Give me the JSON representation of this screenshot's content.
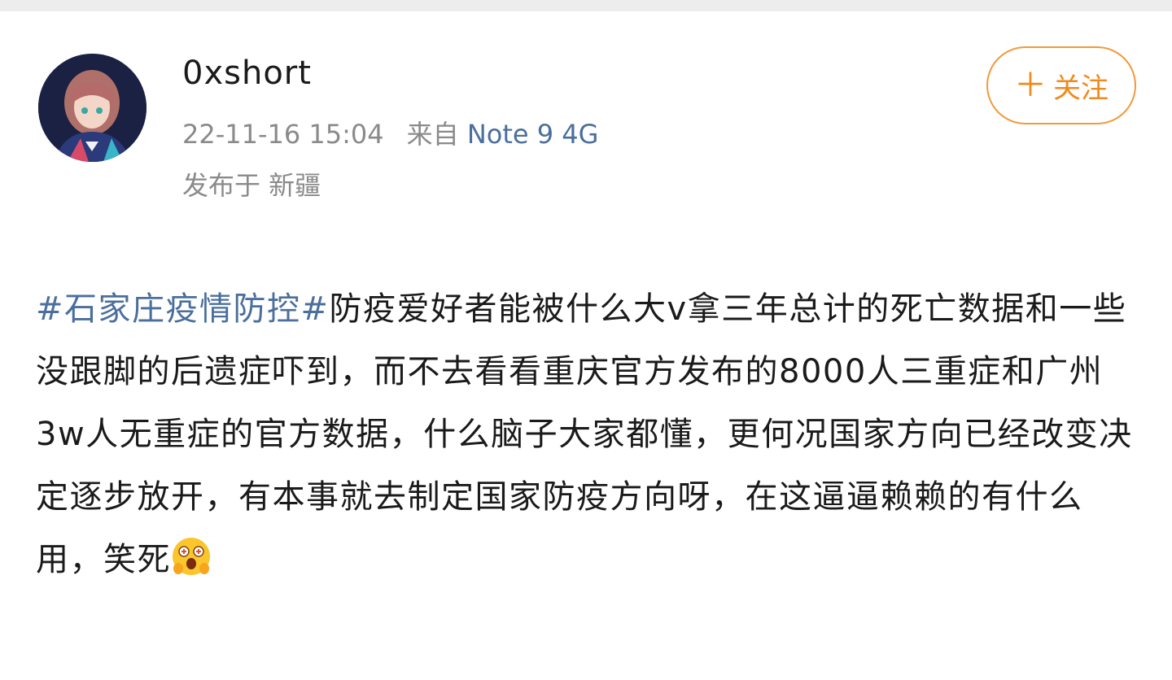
{
  "post": {
    "author": {
      "username": "0xshort",
      "avatar_icon": "avatar-anime-girl"
    },
    "timestamp": "22-11-16 15:04",
    "source_prefix": "来自",
    "device": "Note 9 4G",
    "location": "发布于 新疆",
    "follow_button": {
      "icon": "plus-icon",
      "label": "关注"
    },
    "hashtag": "#石家庄疫情防控#",
    "body": "防疫爱好者能被什么大v拿三年总计的死亡数据和一些没跟脚的后遗症吓到，而不去看看重庆官方发布的8000人三重症和广州3w人无重症的官方数据，什么脑子大家都懂，更何况国家方向已经改变决定逐步放开，有本事就去制定国家防疫方向呀，在这逼逼赖赖的有什么用，笑死",
    "trailing_emoji": "shocked-face-emoji"
  },
  "colors": {
    "link": "#4a6f9d",
    "accent": "#f08a1c",
    "meta": "#8a8a8a",
    "text": "#1a1a1a"
  }
}
